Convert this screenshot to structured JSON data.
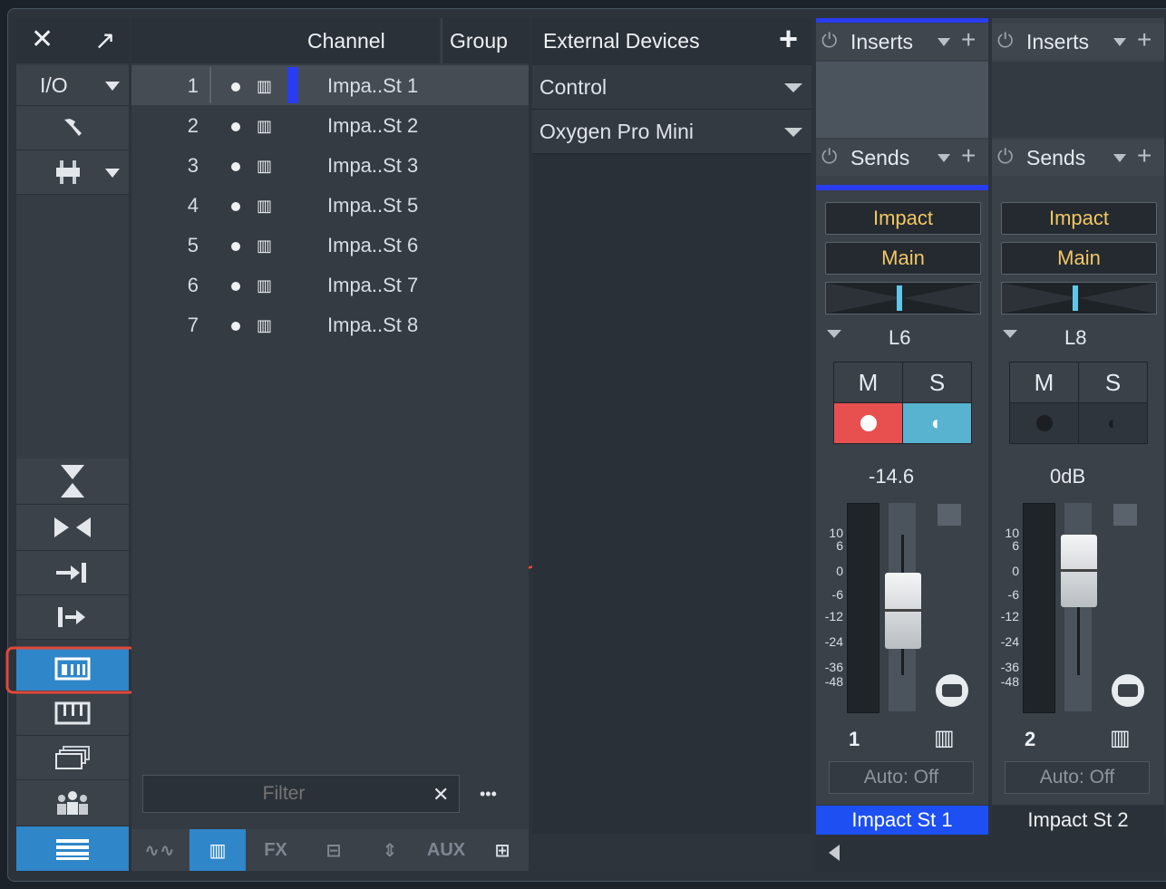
{
  "left_toolbar": {
    "close_glyph": "✕",
    "expand_glyph": "↗",
    "io_label": "I/O",
    "icons": [
      "wrench-icon",
      "input-routing-icon",
      "collapse-vertical-icon",
      "collapse-horizontal-icon",
      "arrow-into-bar-icon",
      "bar-arrow-out-icon",
      "channel-list-icon",
      "keyboard-icon",
      "stacked-keyboards-icon",
      "people-icon",
      "list-lines-icon"
    ]
  },
  "channel_list": {
    "headers": {
      "channel": "Channel",
      "group": "Group"
    },
    "rows": [
      {
        "num": "1",
        "name": "Impa..St 1"
      },
      {
        "num": "2",
        "name": "Impa..St 2"
      },
      {
        "num": "3",
        "name": "Impa..St 3"
      },
      {
        "num": "4",
        "name": "Impa..St 5"
      },
      {
        "num": "5",
        "name": "Impa..St 6"
      },
      {
        "num": "6",
        "name": "Impa..St 7"
      },
      {
        "num": "7",
        "name": "Impa..St 8"
      }
    ],
    "filter_placeholder": "Filter",
    "more_glyph": "•••",
    "tabs": [
      "∿∿",
      "▥",
      "FX",
      "⊟",
      "⇕",
      "AUX",
      "⊞"
    ]
  },
  "external_devices": {
    "title": "External Devices",
    "add_glyph": "+",
    "items": [
      "Control",
      "Oxygen Pro Mini"
    ]
  },
  "strips": [
    {
      "inserts": "Inserts",
      "sends": "Sends",
      "instrument": "Impact",
      "output": "Main",
      "pan": "L6",
      "mute": "M",
      "solo": "S",
      "level": "-14.6",
      "number": "1",
      "auto": "Auto: Off",
      "name": "Impact St 1",
      "selected": true
    },
    {
      "inserts": "Inserts",
      "sends": "Sends",
      "instrument": "Impact",
      "output": "Main",
      "pan": "L8",
      "mute": "M",
      "solo": "S",
      "level": "0dB",
      "number": "2",
      "auto": "Auto: Off",
      "name": "Impact St 2",
      "selected": false
    }
  ],
  "meter_scale": [
    "10",
    "6",
    "0",
    "-6",
    "-12",
    "-24",
    "-36",
    "-48"
  ],
  "colors": {
    "accent": "#2f86c9",
    "record": "#e85050",
    "monitor": "#57b3cf",
    "highlight": "#e0493a",
    "bus": "#f3c764"
  }
}
